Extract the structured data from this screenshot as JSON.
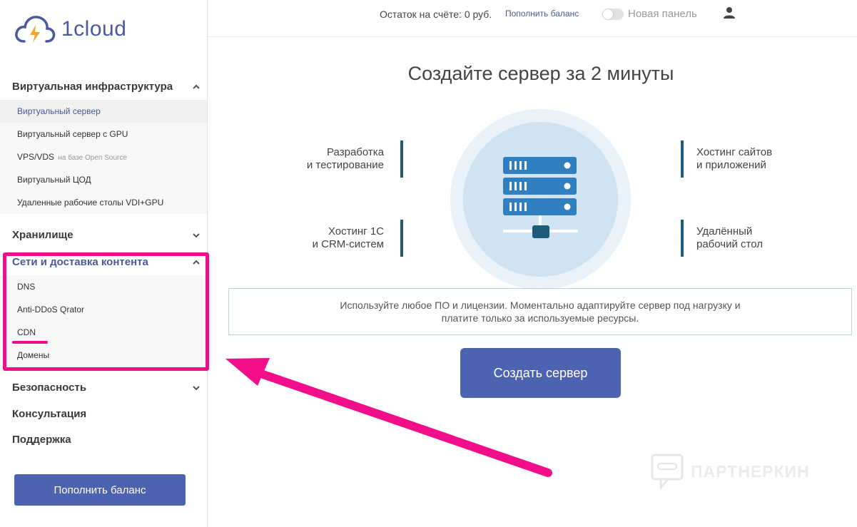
{
  "logo": {
    "text": "1cloud"
  },
  "sidebar": {
    "sections": [
      {
        "title": "Виртуальная инфраструктура",
        "expanded": true,
        "items": [
          {
            "label": "Виртуальный сервер",
            "active": true
          },
          {
            "label": "Виртуальный сервер с GPU"
          },
          {
            "label": "VPS/VDS",
            "suffix": "на базе Open Source"
          },
          {
            "label": "Виртуальный ЦОД"
          },
          {
            "label": "Удаленные рабочие столы VDI+GPU"
          }
        ]
      },
      {
        "title": "Хранилище",
        "expanded": false
      },
      {
        "title": "Сети и доставка контента",
        "expanded": true,
        "items": [
          {
            "label": "DNS"
          },
          {
            "label": "Anti-DDoS Qrator"
          },
          {
            "label": "CDN"
          },
          {
            "label": "Домены"
          }
        ]
      },
      {
        "title": "Безопасность",
        "expanded": false
      },
      {
        "title": "Консультация"
      },
      {
        "title": "Поддержка"
      }
    ],
    "button": "Пополнить баланс"
  },
  "topbar": {
    "balance": "Остаток на счёте: 0 руб.",
    "topup_link": "Пополнить баланс",
    "new_panel": "Новая панель",
    "new_panel_toggle_on": false
  },
  "hero": {
    "title": "Создайте сервер за 2 минуты",
    "features": {
      "top_left": [
        "Разработка",
        "и тестирование"
      ],
      "bottom_left": [
        "Хостинг 1С",
        "и CRM-систем"
      ],
      "top_right": [
        "Хостинг сайтов",
        "и приложений"
      ],
      "bottom_right": [
        "Удалённый",
        "рабочий стол"
      ]
    },
    "info": "Используйте любое ПО и лицензии. Моментально адаптируйте сервер под нагрузку и платите только за используемые ресурсы.",
    "create_button": "Создать сервер"
  },
  "watermark": "ПАРТНЕРКИН",
  "colors": {
    "accent": "#4e63b0",
    "highlight": "#f20d8a",
    "link": "#4a5a9a",
    "feature_bar": "#1e5a7a"
  }
}
